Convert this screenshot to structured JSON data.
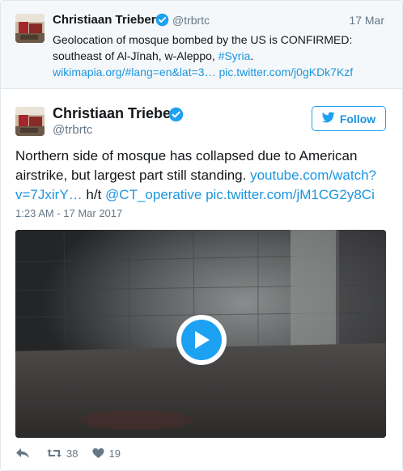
{
  "parent_tweet": {
    "name": "Christiaan Triebert",
    "handle": "@trbrtc",
    "date": "17 Mar",
    "text": "Geolocation of mosque bombed by the US is CONFIRMED: southeast of Al-Jīnah, w-Aleppo, ",
    "hashtag": "#Syria",
    "period": ".",
    "link1": "wikimapia.org/#lang=en&lat=3…",
    "link2": "pic.twitter.com/j0gKDk7Kzf"
  },
  "main_tweet": {
    "name": "Christiaan Triebert",
    "handle": "@trbrtc",
    "follow_label": "Follow",
    "text_part1": "Northern side of mosque has collapsed due to American airstrike, but largest part still standing. ",
    "link_youtube": "youtube.com/watch?v=7JxirY…",
    "ht": " h/t ",
    "mention": "@CT_operative",
    "space": " ",
    "link_pic": "pic.twitter.com/jM1CG2y8Ci",
    "timestamp": "1:23 AM - 17 Mar 2017",
    "retweets": "38",
    "likes": "19"
  },
  "colors": {
    "accent": "#1da1f2",
    "link": "#1b95e0",
    "muted": "#657786"
  },
  "icons": [
    "verified-badge-icon",
    "twitter-bird-icon",
    "play-icon",
    "reply-icon",
    "retweet-icon",
    "heart-icon"
  ]
}
